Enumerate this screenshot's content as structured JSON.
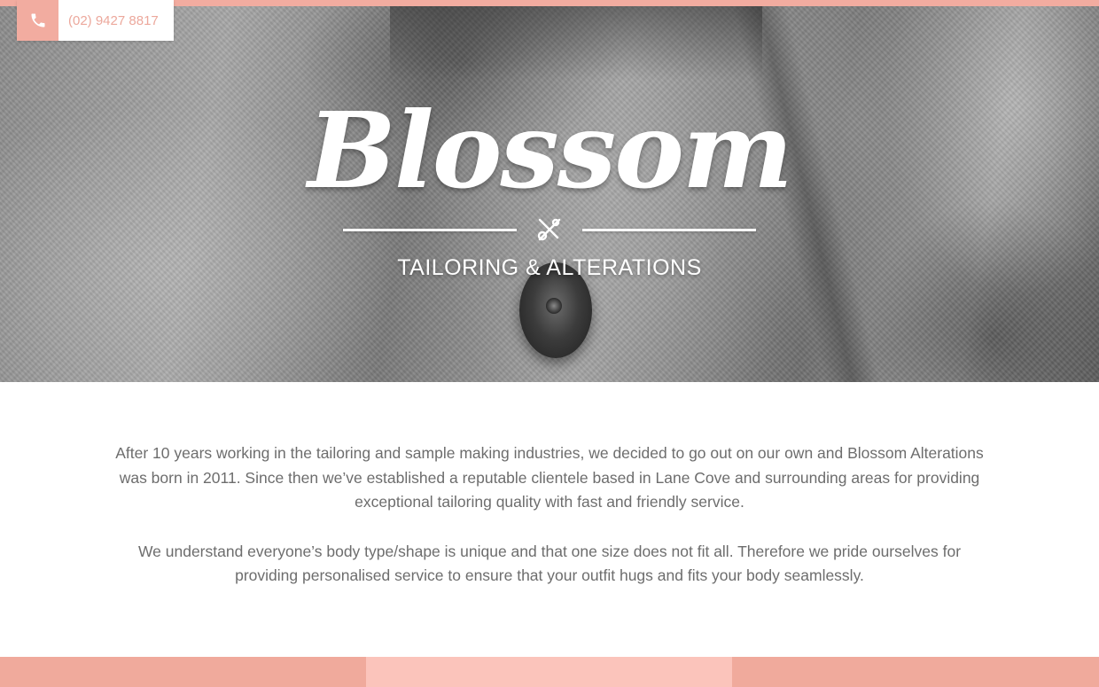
{
  "header": {
    "phone": "(02) 9427 8817",
    "phone_icon": "phone-icon"
  },
  "hero": {
    "brand_name": "Blossom",
    "tagline": "TAILORING & ALTERATIONS",
    "emblem_icon": "needle-and-scissors-icon"
  },
  "intro": {
    "paragraphs": [
      "After 10 years working in the tailoring and sample making industries, we decided to go out on our own and Blossom Alterations was born in 2011. Since then we’ve established a reputable clientele based in Lane Cove and surrounding areas for providing exceptional tailoring quality with fast and friendly service.",
      "We understand everyone’s body type/shape is unique and that one size does not fit all. Therefore we pride ourselves for providing personalised service to ensure that your outfit hugs and fits your body seamlessly."
    ]
  },
  "colors": {
    "accent": "#f2aca0",
    "accent_light": "#fbc4bb",
    "body_text": "#6d6d6d",
    "phone_text": "#eca89c"
  }
}
